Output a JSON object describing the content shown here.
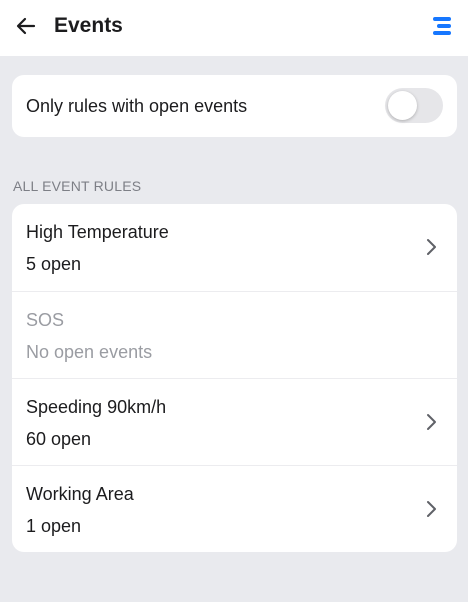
{
  "header": {
    "title": "Events",
    "back_icon": "arrow-left-icon",
    "menu_icon": "menu-icon",
    "accent_color": "#1677ff"
  },
  "filter": {
    "label": "Only rules with open events",
    "toggle_on": false
  },
  "section": {
    "label": "ALL EVENT RULES"
  },
  "rules": [
    {
      "name": "High Temperature",
      "status": "5 open",
      "enabled": true
    },
    {
      "name": "SOS",
      "status": "No open events",
      "enabled": false
    },
    {
      "name": "Speeding 90km/h",
      "status": "60 open",
      "enabled": true
    },
    {
      "name": "Working Area",
      "status": "1 open",
      "enabled": true
    }
  ]
}
